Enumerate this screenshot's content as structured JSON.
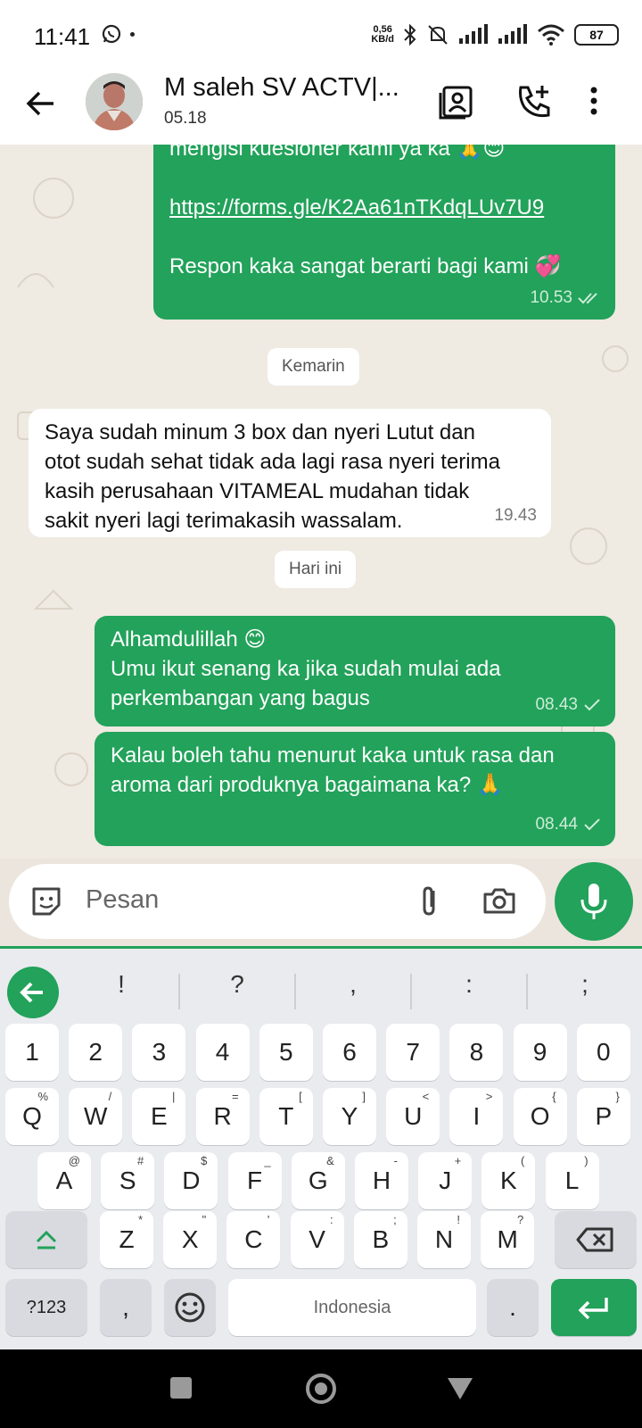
{
  "status": {
    "time": "11:41",
    "speed_top": "0,56",
    "speed_bottom": "KB/d",
    "battery": "87"
  },
  "header": {
    "name": "M saleh SV ACTV|...",
    "subtitle": "05.18"
  },
  "messages": {
    "first": {
      "lines": [
        "mengisi kuesioner kami ya ka 🙏😊",
        "",
        "https://forms.gle/K2Aa61nTKdqLUv7U9",
        "",
        "Respon kaka sangat berarti bagi kami 💞"
      ],
      "time": "10.53"
    },
    "date1": "Kemarin",
    "second": {
      "lines": [
        "Saya sudah minum 3 box dan nyeri Lutut dan",
        "otot sudah sehat tidak ada lagi rasa nyeri  terima",
        "kasih perusahaan VITAMEAL  mudahan  tidak",
        "sakit nyeri lagi terimakasih wassalam."
      ],
      "time": "19.43"
    },
    "date2": "Hari ini",
    "third": {
      "lines": [
        "Alhamdulillah 😊",
        "Umu ikut senang ka jika sudah mulai ada",
        "perkembangan yang bagus"
      ],
      "time": "08.43"
    },
    "fourth": {
      "lines": [
        "Kalau boleh tahu menurut kaka untuk rasa dan",
        "aroma dari produknya bagaimana ka? 🙏"
      ],
      "time": "08.44"
    }
  },
  "composer": {
    "placeholder": "Pesan"
  },
  "keyboard": {
    "suggestions": [
      "!",
      "?",
      ",",
      ":",
      ";"
    ],
    "numbers": [
      "1",
      "2",
      "3",
      "4",
      "5",
      "6",
      "7",
      "8",
      "9",
      "0"
    ],
    "row1": [
      [
        "Q",
        "%"
      ],
      [
        "W",
        "/"
      ],
      [
        "E",
        "|"
      ],
      [
        "R",
        "="
      ],
      [
        "T",
        "["
      ],
      [
        "Y",
        "]"
      ],
      [
        "U",
        "<"
      ],
      [
        "I",
        ">"
      ],
      [
        "O",
        "{"
      ],
      [
        "P",
        "}"
      ]
    ],
    "row2": [
      [
        "A",
        "@"
      ],
      [
        "S",
        "#"
      ],
      [
        "D",
        "$"
      ],
      [
        "F",
        "_"
      ],
      [
        "G",
        "&"
      ],
      [
        "H",
        "-"
      ],
      [
        "J",
        "+"
      ],
      [
        "K",
        "("
      ],
      [
        "L",
        ")"
      ]
    ],
    "row3": [
      [
        "Z",
        "*"
      ],
      [
        "X",
        "\""
      ],
      [
        "C",
        "'"
      ],
      [
        "V",
        ":"
      ],
      [
        "B",
        ";"
      ],
      [
        "N",
        "!"
      ],
      [
        "M",
        "?"
      ]
    ],
    "sym_key": "?123",
    "comma": ",",
    "space": "Indonesia",
    "period": "."
  },
  "colors": {
    "accent": "#22A25A",
    "chat_bg": "#EFEAE2"
  }
}
